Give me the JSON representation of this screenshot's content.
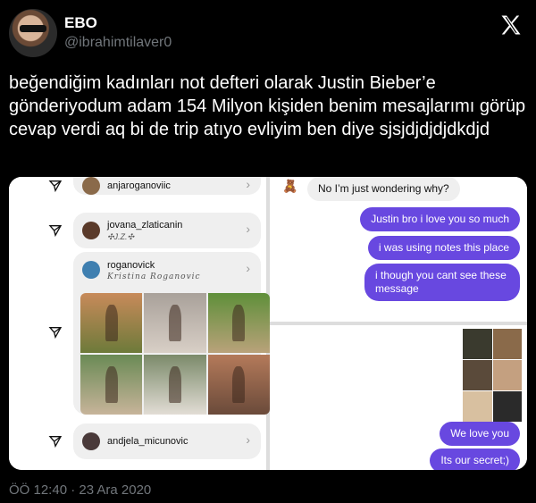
{
  "author": {
    "name": "EBO",
    "handle": "@ibrahimtilaver0"
  },
  "tweet": {
    "text": "beğendiğim kadınları not defteri olarak Justin Bieber’e gönderiyodum adam 154 Milyon kişiden benim mesajlarımı görüp cevap verdi aq bi de trip atıyo evliyim ben diye sjsjdjdjdjdkdjd"
  },
  "media": {
    "shares": [
      {
        "username": "anjaroganoviic",
        "subtitle": ""
      },
      {
        "username": "jovana_zlaticanin",
        "subtitle": "✣J.Z.✣"
      },
      {
        "username": "roganovick",
        "subtitle": "Kristina Roganovic"
      },
      {
        "username": "andjela_micunovic",
        "subtitle": ""
      }
    ],
    "chat_top": {
      "reply": "No I’m just wondering why?",
      "messages": [
        "Justin bro i love you so much",
        "i was using notes this place",
        "i though you cant see these message"
      ]
    },
    "chat_bottom": {
      "messages": [
        "We love you",
        "Its our secret;)"
      ]
    }
  },
  "footer": {
    "timestamp": "ÖÖ 12:40 · 23 Ara 2020"
  }
}
